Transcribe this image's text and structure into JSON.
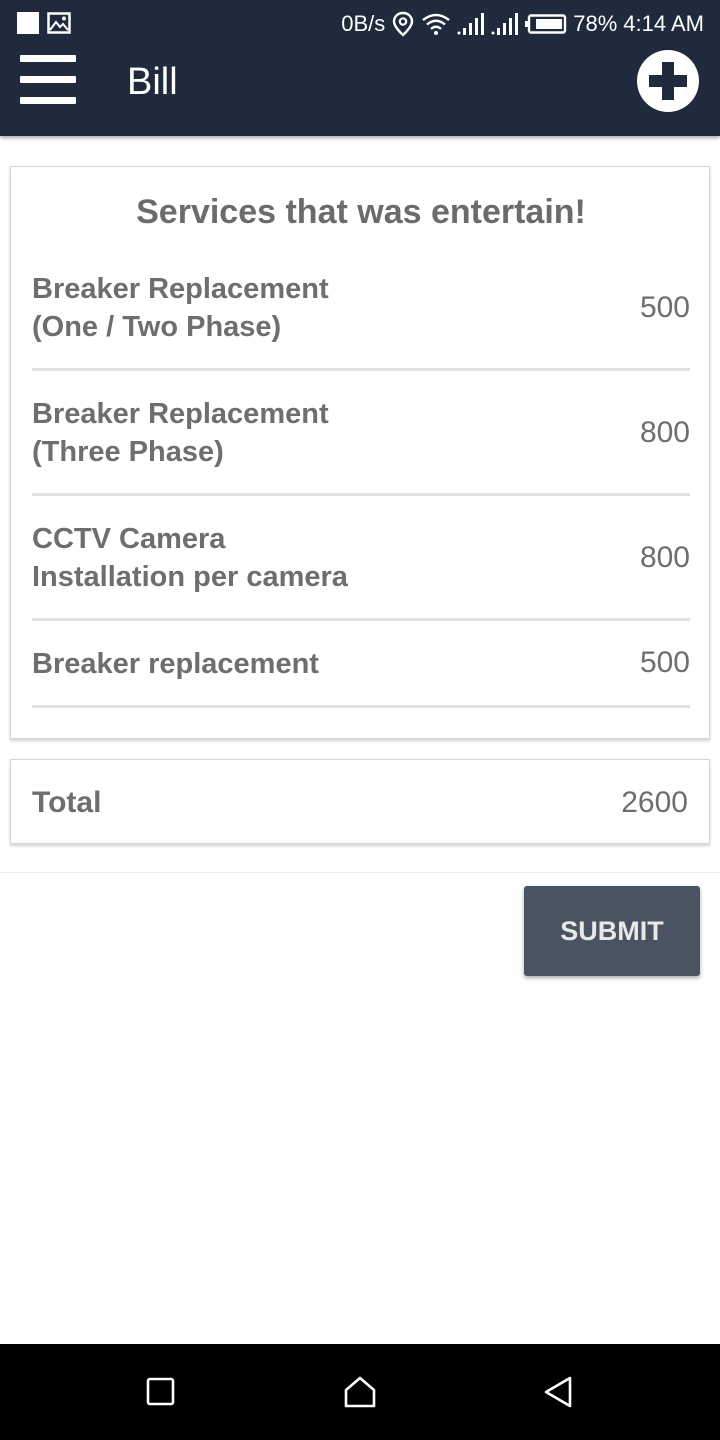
{
  "status_bar": {
    "net_speed": "0B/s",
    "battery": "78%",
    "time": "4:14 AM",
    "icons": [
      "notification-square-icon",
      "gallery-icon",
      "location-icon",
      "wifi-icon",
      "signal-icon",
      "signal-icon",
      "battery-icon"
    ]
  },
  "app_bar": {
    "title": "Bill",
    "menu_icon": "hamburger-menu-icon",
    "add_icon": "plus-circle-icon",
    "background": "#1f2b3c"
  },
  "services": {
    "heading": "Services that was entertain!",
    "items": [
      {
        "name_line1": "Breaker Replacement",
        "name_line2": "(One / Two Phase)",
        "price": "500"
      },
      {
        "name_line1": "Breaker Replacement",
        "name_line2": "(Three Phase)",
        "price": "800"
      },
      {
        "name_line1": "CCTV Camera",
        "name_line2": "Installation per camera",
        "price": "800"
      },
      {
        "name_line1": "Breaker replacement",
        "name_line2": "",
        "price": "500"
      }
    ]
  },
  "total": {
    "label": "Total",
    "value": "2600"
  },
  "submit": {
    "label": "SUBMIT",
    "color": "#4a5361"
  },
  "nav_bar": {
    "icons": [
      "recents-square-icon",
      "home-icon",
      "back-triangle-icon"
    ]
  }
}
